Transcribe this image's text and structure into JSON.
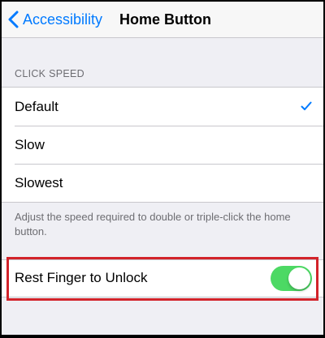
{
  "nav": {
    "back_label": "Accessibility",
    "title": "Home Button",
    "back_icon": "chevron-left-icon"
  },
  "click_speed": {
    "header": "CLICK SPEED",
    "options": [
      {
        "label": "Default",
        "selected": true
      },
      {
        "label": "Slow",
        "selected": false
      },
      {
        "label": "Slowest",
        "selected": false
      }
    ],
    "footer": "Adjust the speed required to double or triple-click the home button."
  },
  "rest_finger": {
    "label": "Rest Finger to Unlock",
    "enabled": true
  },
  "colors": {
    "accent": "#007aff",
    "toggle_on": "#4cd964",
    "highlight": "#d2232a",
    "background": "#efeff4"
  }
}
